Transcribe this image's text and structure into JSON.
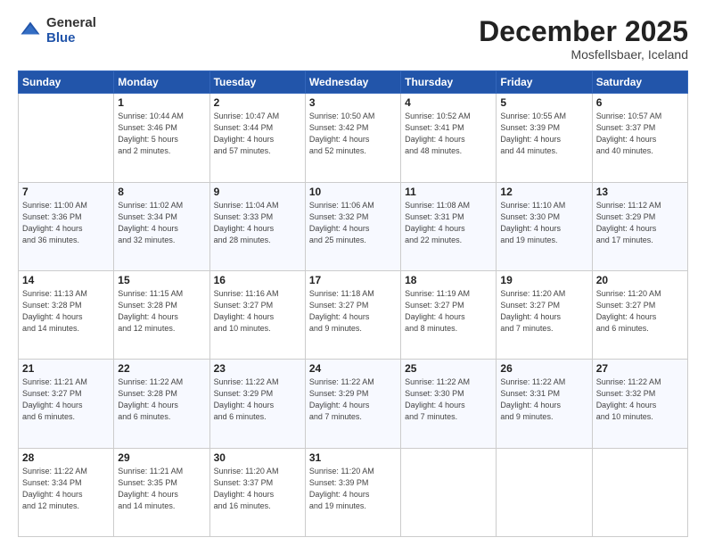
{
  "header": {
    "logo_general": "General",
    "logo_blue": "Blue",
    "month": "December 2025",
    "location": "Mosfellsbaer, Iceland"
  },
  "days_of_week": [
    "Sunday",
    "Monday",
    "Tuesday",
    "Wednesday",
    "Thursday",
    "Friday",
    "Saturday"
  ],
  "weeks": [
    [
      {
        "day": "",
        "info": ""
      },
      {
        "day": "1",
        "info": "Sunrise: 10:44 AM\nSunset: 3:46 PM\nDaylight: 5 hours\nand 2 minutes."
      },
      {
        "day": "2",
        "info": "Sunrise: 10:47 AM\nSunset: 3:44 PM\nDaylight: 4 hours\nand 57 minutes."
      },
      {
        "day": "3",
        "info": "Sunrise: 10:50 AM\nSunset: 3:42 PM\nDaylight: 4 hours\nand 52 minutes."
      },
      {
        "day": "4",
        "info": "Sunrise: 10:52 AM\nSunset: 3:41 PM\nDaylight: 4 hours\nand 48 minutes."
      },
      {
        "day": "5",
        "info": "Sunrise: 10:55 AM\nSunset: 3:39 PM\nDaylight: 4 hours\nand 44 minutes."
      },
      {
        "day": "6",
        "info": "Sunrise: 10:57 AM\nSunset: 3:37 PM\nDaylight: 4 hours\nand 40 minutes."
      }
    ],
    [
      {
        "day": "7",
        "info": "Sunrise: 11:00 AM\nSunset: 3:36 PM\nDaylight: 4 hours\nand 36 minutes."
      },
      {
        "day": "8",
        "info": "Sunrise: 11:02 AM\nSunset: 3:34 PM\nDaylight: 4 hours\nand 32 minutes."
      },
      {
        "day": "9",
        "info": "Sunrise: 11:04 AM\nSunset: 3:33 PM\nDaylight: 4 hours\nand 28 minutes."
      },
      {
        "day": "10",
        "info": "Sunrise: 11:06 AM\nSunset: 3:32 PM\nDaylight: 4 hours\nand 25 minutes."
      },
      {
        "day": "11",
        "info": "Sunrise: 11:08 AM\nSunset: 3:31 PM\nDaylight: 4 hours\nand 22 minutes."
      },
      {
        "day": "12",
        "info": "Sunrise: 11:10 AM\nSunset: 3:30 PM\nDaylight: 4 hours\nand 19 minutes."
      },
      {
        "day": "13",
        "info": "Sunrise: 11:12 AM\nSunset: 3:29 PM\nDaylight: 4 hours\nand 17 minutes."
      }
    ],
    [
      {
        "day": "14",
        "info": "Sunrise: 11:13 AM\nSunset: 3:28 PM\nDaylight: 4 hours\nand 14 minutes."
      },
      {
        "day": "15",
        "info": "Sunrise: 11:15 AM\nSunset: 3:28 PM\nDaylight: 4 hours\nand 12 minutes."
      },
      {
        "day": "16",
        "info": "Sunrise: 11:16 AM\nSunset: 3:27 PM\nDaylight: 4 hours\nand 10 minutes."
      },
      {
        "day": "17",
        "info": "Sunrise: 11:18 AM\nSunset: 3:27 PM\nDaylight: 4 hours\nand 9 minutes."
      },
      {
        "day": "18",
        "info": "Sunrise: 11:19 AM\nSunset: 3:27 PM\nDaylight: 4 hours\nand 8 minutes."
      },
      {
        "day": "19",
        "info": "Sunrise: 11:20 AM\nSunset: 3:27 PM\nDaylight: 4 hours\nand 7 minutes."
      },
      {
        "day": "20",
        "info": "Sunrise: 11:20 AM\nSunset: 3:27 PM\nDaylight: 4 hours\nand 6 minutes."
      }
    ],
    [
      {
        "day": "21",
        "info": "Sunrise: 11:21 AM\nSunset: 3:27 PM\nDaylight: 4 hours\nand 6 minutes."
      },
      {
        "day": "22",
        "info": "Sunrise: 11:22 AM\nSunset: 3:28 PM\nDaylight: 4 hours\nand 6 minutes."
      },
      {
        "day": "23",
        "info": "Sunrise: 11:22 AM\nSunset: 3:29 PM\nDaylight: 4 hours\nand 6 minutes."
      },
      {
        "day": "24",
        "info": "Sunrise: 11:22 AM\nSunset: 3:29 PM\nDaylight: 4 hours\nand 7 minutes."
      },
      {
        "day": "25",
        "info": "Sunrise: 11:22 AM\nSunset: 3:30 PM\nDaylight: 4 hours\nand 7 minutes."
      },
      {
        "day": "26",
        "info": "Sunrise: 11:22 AM\nSunset: 3:31 PM\nDaylight: 4 hours\nand 9 minutes."
      },
      {
        "day": "27",
        "info": "Sunrise: 11:22 AM\nSunset: 3:32 PM\nDaylight: 4 hours\nand 10 minutes."
      }
    ],
    [
      {
        "day": "28",
        "info": "Sunrise: 11:22 AM\nSunset: 3:34 PM\nDaylight: 4 hours\nand 12 minutes."
      },
      {
        "day": "29",
        "info": "Sunrise: 11:21 AM\nSunset: 3:35 PM\nDaylight: 4 hours\nand 14 minutes."
      },
      {
        "day": "30",
        "info": "Sunrise: 11:20 AM\nSunset: 3:37 PM\nDaylight: 4 hours\nand 16 minutes."
      },
      {
        "day": "31",
        "info": "Sunrise: 11:20 AM\nSunset: 3:39 PM\nDaylight: 4 hours\nand 19 minutes."
      },
      {
        "day": "",
        "info": ""
      },
      {
        "day": "",
        "info": ""
      },
      {
        "day": "",
        "info": ""
      }
    ]
  ]
}
